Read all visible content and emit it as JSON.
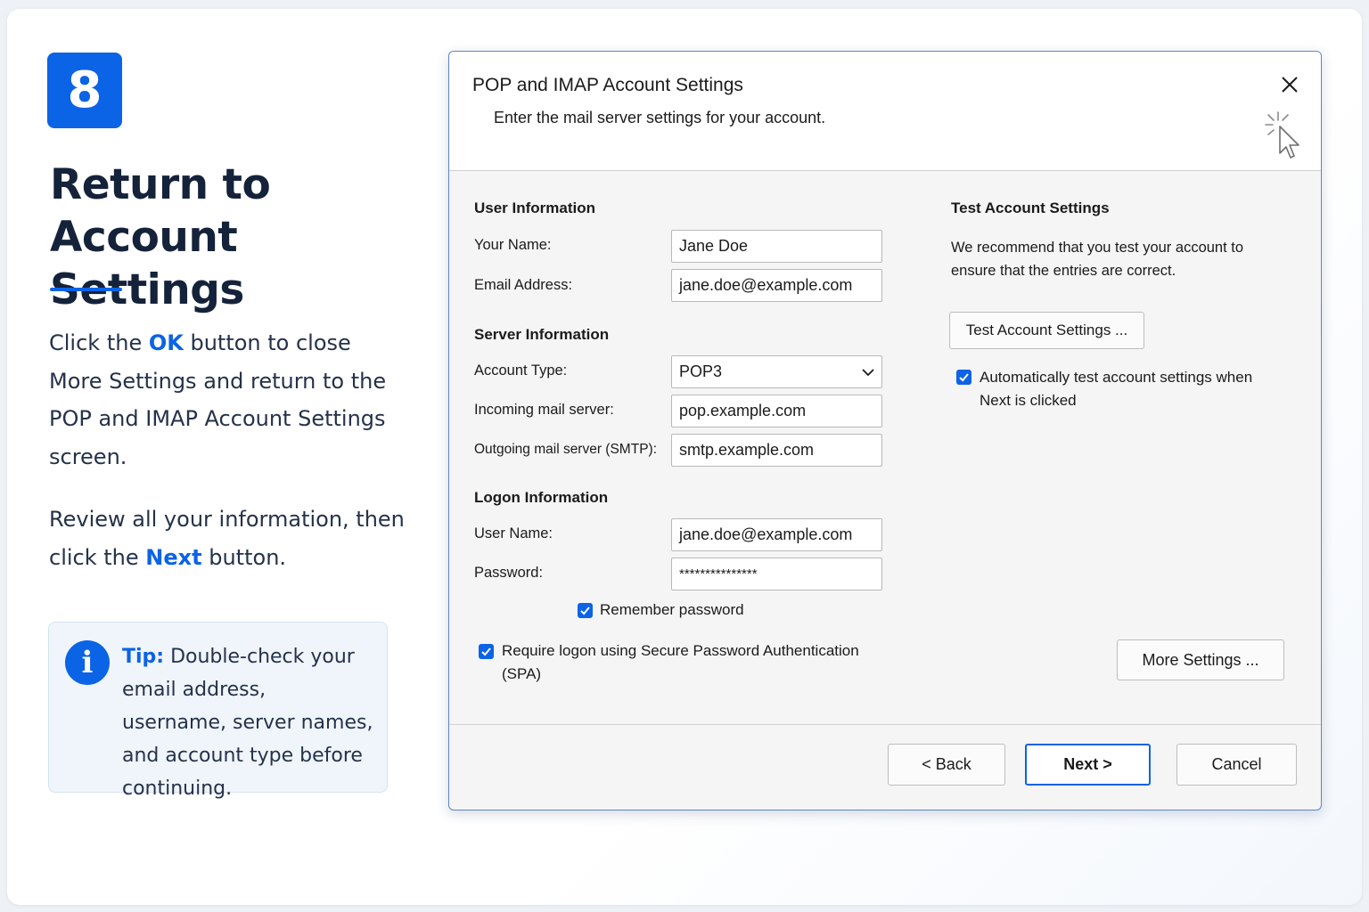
{
  "guide": {
    "step_number": "8",
    "title_line1": "Return to",
    "title_line2": "Account Settings",
    "instr1": {
      "pre": "Click the ",
      "highlight": "OK",
      "post": " button to close More Settings and return to the POP and IMAP Account Settings screen."
    },
    "instr2": {
      "pre": "Review all your information, then click the ",
      "highlight": "Next",
      "post": " button."
    },
    "tip": {
      "icon": "i",
      "label": "Tip:",
      "text": " Double-check your email address, username, server names, and account type before continuing."
    }
  },
  "dialog": {
    "title": "POP and IMAP Account Settings",
    "subtitle": "Enter the mail server settings for your account.",
    "user_info": {
      "heading": "User Information",
      "name_label": "Your Name:",
      "name_value": "Jane Doe",
      "email_label": "Email Address:",
      "email_value": "jane.doe@example.com"
    },
    "server_info": {
      "heading": "Server Information",
      "type_label": "Account Type:",
      "type_value": "POP3",
      "incoming_label": "Incoming mail server:",
      "incoming_value": "pop.example.com",
      "outgoing_label": "Outgoing mail server (SMTP):",
      "outgoing_value": "smtp.example.com"
    },
    "logon_info": {
      "heading": "Logon Information",
      "user_label": "User Name:",
      "user_value": "jane.doe@example.com",
      "password_label": "Password:",
      "password_value": "***************",
      "remember_label": "Remember password",
      "remember_checked": true,
      "spa_label": "Require logon using Secure Password Authentication (SPA)",
      "spa_checked": true
    },
    "test": {
      "heading": "Test Account Settings",
      "description": "We recommend that you test your account to ensure that the entries are correct.",
      "button": "Test Account Settings ...",
      "auto_label": "Automatically test account settings when Next is clicked",
      "auto_checked": true
    },
    "more_settings_button": "More Settings ...",
    "back_button": "< Back",
    "next_button": "Next >",
    "cancel_button": "Cancel"
  },
  "colors": {
    "accent": "#0b63e5",
    "dialog_border": "#5d86c9"
  },
  "icons": {
    "close": "close-icon",
    "cursor": "click-cursor-icon",
    "dropdown": "chevron-down-icon",
    "info": "info-icon",
    "check": "checkmark-icon"
  }
}
